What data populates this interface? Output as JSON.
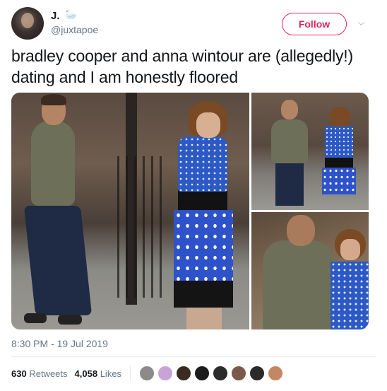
{
  "author": {
    "display_name": "J.",
    "name_emoji": "🦢",
    "handle": "@juxtapoe"
  },
  "follow_label": "Follow",
  "tweet_text": "bradley cooper and anna wintour are (allegedly!) dating and I am honestly floored",
  "timestamp": "8:30 PM - 19 Jul 2019",
  "stats": {
    "retweets_count": "630",
    "retweets_label": "Retweets",
    "likes_count": "4,058",
    "likes_label": "Likes"
  },
  "liker_avatars": [
    {
      "color": "#8a8a8a"
    },
    {
      "color": "#c9a3d6"
    },
    {
      "color": "#3a2b22"
    },
    {
      "color": "#1c1c1c"
    },
    {
      "color": "#2b2b2b"
    },
    {
      "color": "#7a5a4a"
    },
    {
      "color": "#2a2a2a"
    },
    {
      "color": "#c48763"
    }
  ],
  "colors": {
    "follow_accent": "#e0245e",
    "text_primary": "#14171a",
    "text_secondary": "#657786"
  }
}
